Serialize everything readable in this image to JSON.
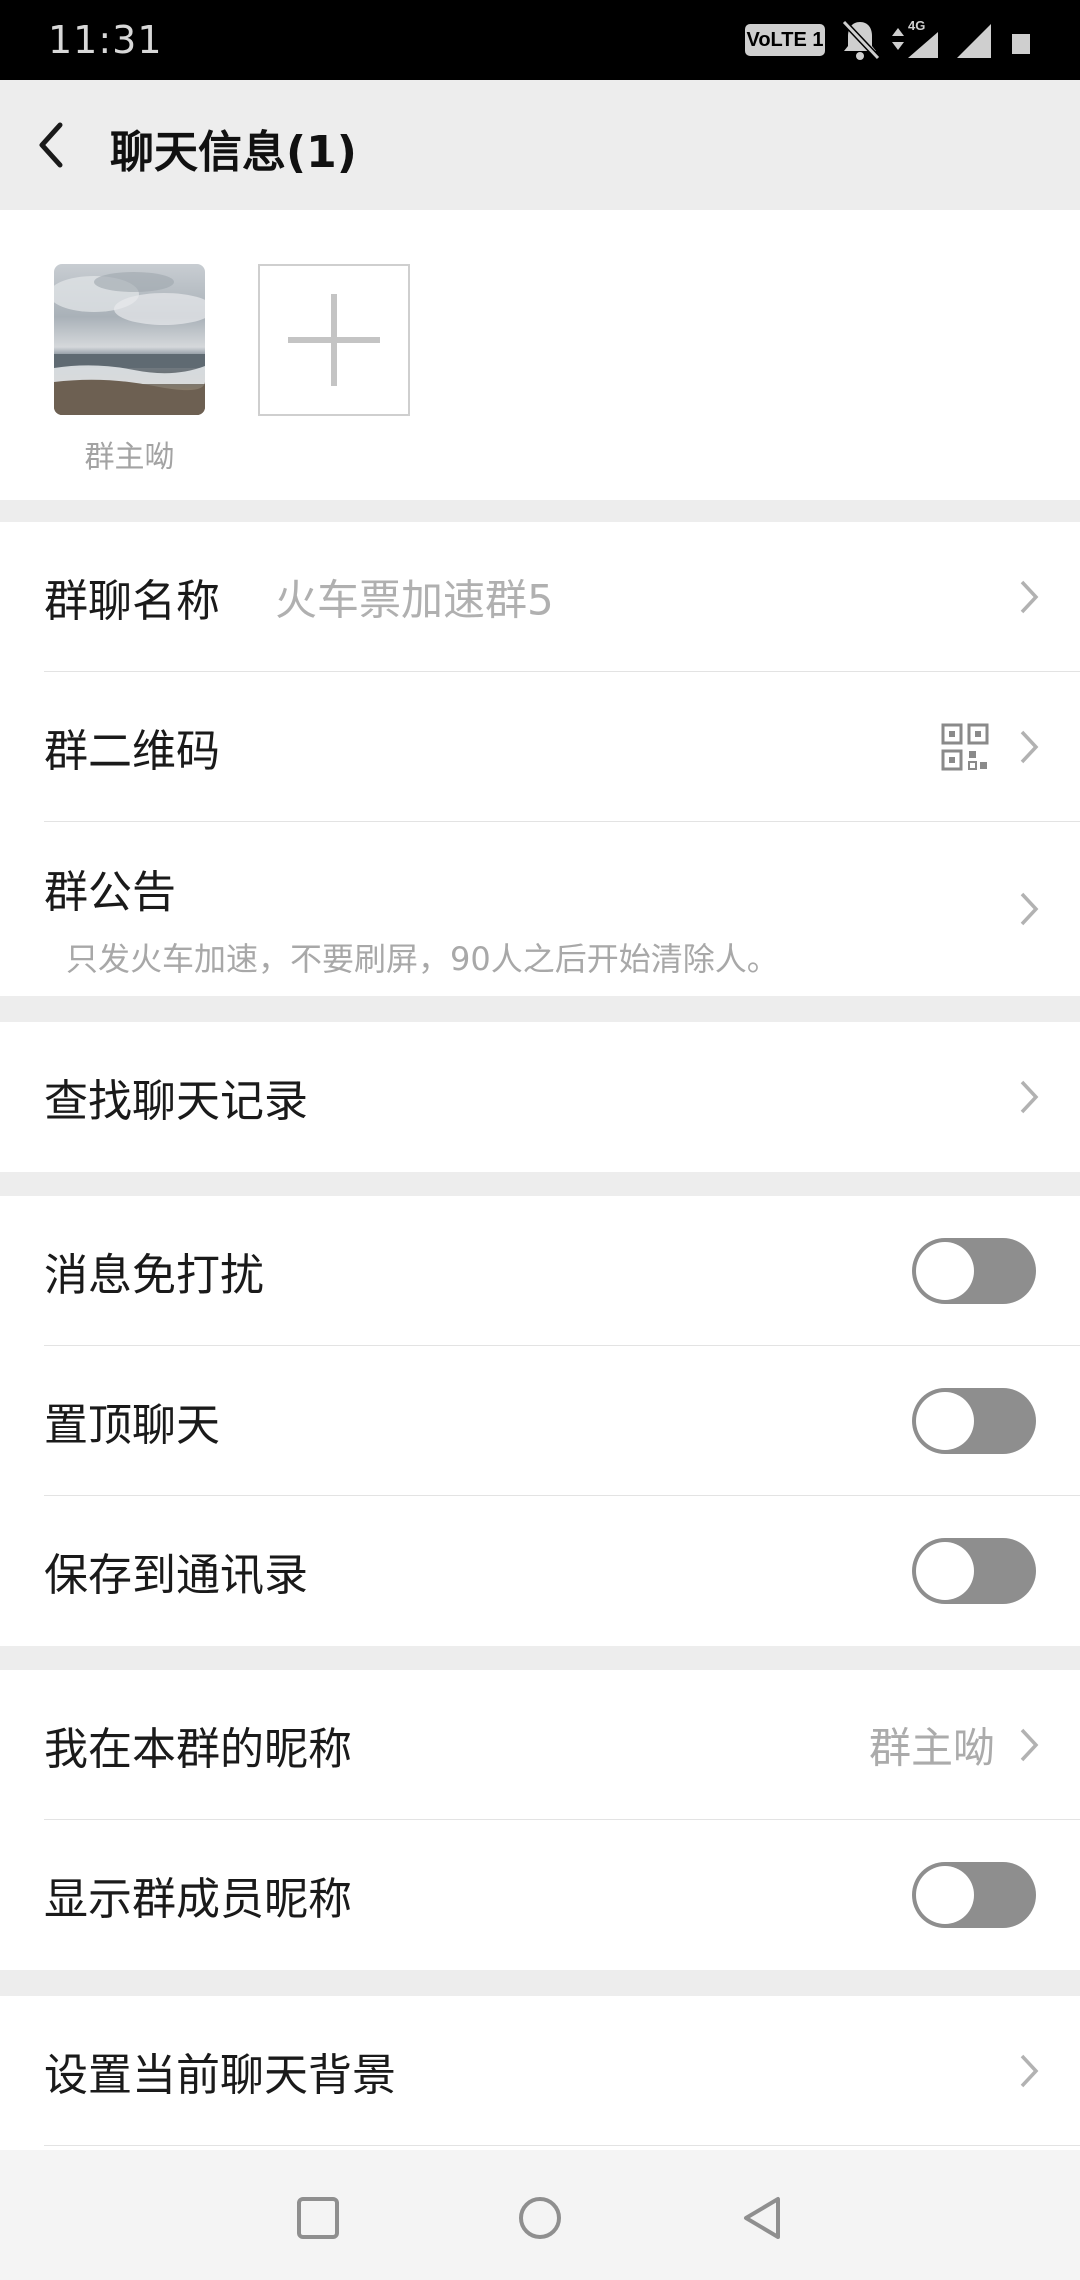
{
  "status_bar": {
    "time": "11:31",
    "volte_label": "VoLTE 1",
    "network_label": "4G"
  },
  "header": {
    "title": "聊天信息(1)"
  },
  "members": [
    {
      "name": "群主呦"
    }
  ],
  "rows": {
    "group_name": {
      "label": "群聊名称",
      "value": "火车票加速群5"
    },
    "qr_code": {
      "label": "群二维码"
    },
    "announcement": {
      "label": "群公告",
      "text": "只发火车加速，不要刷屏，90人之后开始清除人。"
    },
    "search_history": {
      "label": "查找聊天记录"
    },
    "mute": {
      "label": "消息免打扰",
      "on": false
    },
    "pin": {
      "label": "置顶聊天",
      "on": false
    },
    "save_contacts": {
      "label": "保存到通讯录",
      "on": false
    },
    "my_nickname": {
      "label": "我在本群的昵称",
      "value": "群主呦"
    },
    "show_nicknames": {
      "label": "显示群成员昵称",
      "on": false
    },
    "chat_background": {
      "label": "设置当前聊天背景"
    }
  },
  "colors": {
    "toggle_off": "#8e8e8e",
    "page_bg": "#ededed",
    "secondary_text": "#b0b0b0"
  }
}
